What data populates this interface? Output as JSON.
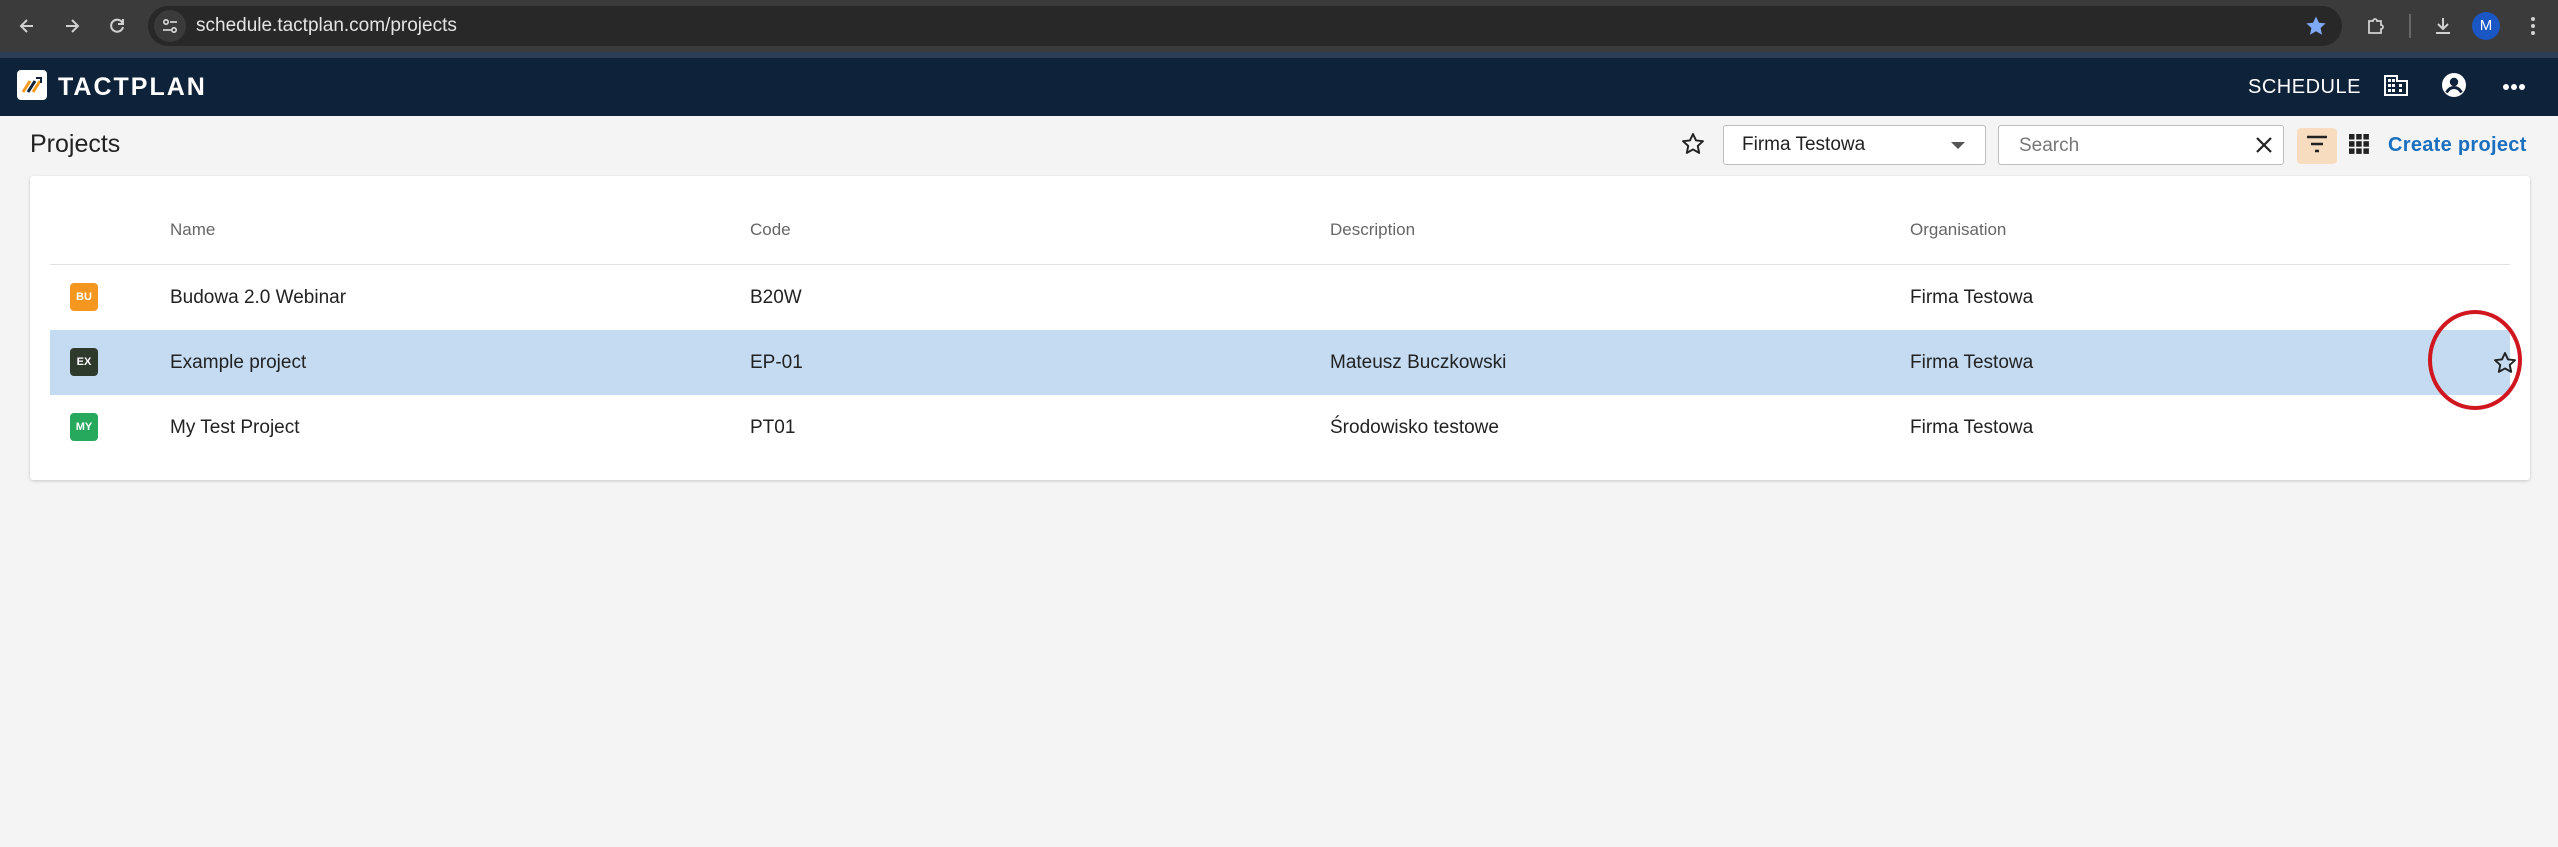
{
  "browser": {
    "url": "schedule.tactplan.com/projects",
    "profile_initial": "M"
  },
  "app": {
    "logo_text": "TACTPLAN",
    "nav_schedule": "SCHEDULE"
  },
  "toolbar": {
    "page_title": "Projects",
    "organisation_selected": "Firma Testowa",
    "search_placeholder": "Search",
    "create_project": "Create project"
  },
  "table": {
    "headers": [
      "Name",
      "Code",
      "Description",
      "Organisation"
    ],
    "rows": [
      {
        "badge": "BU",
        "badge_color": "#f5961f",
        "name": "Budowa 2.0 Webinar",
        "code": "B20W",
        "description": "",
        "organisation": "Firma Testowa",
        "selected": false
      },
      {
        "badge": "EX",
        "badge_color": "#2e3b2c",
        "name": "Example project",
        "code": "EP-01",
        "description": "Mateusz Buczkowski",
        "organisation": "Firma Testowa",
        "selected": true
      },
      {
        "badge": "MY",
        "badge_color": "#27a95d",
        "name": "My Test Project",
        "code": "PT01",
        "description": "Środowisko testowe",
        "organisation": "Firma Testowa",
        "selected": false
      }
    ]
  },
  "colors": {
    "header_bg": "#0e2239",
    "accent_link": "#1a6fbf",
    "selected_row": "#c4dbf2",
    "filter_active": "#f8dcc0",
    "highlight_ring": "#d0161e"
  },
  "icons": {
    "back": "arrow-left-icon",
    "forward": "arrow-right-icon",
    "reload": "reload-icon",
    "site_info": "tune-icon",
    "bookmark": "star-filled-icon",
    "extensions": "puzzle-icon",
    "download": "download-icon",
    "menu": "kebab-menu-icon",
    "organisation": "building-icon",
    "account": "account-circle-icon",
    "more": "more-horizontal-icon",
    "favourite": "star-outline-icon",
    "filter": "filter-icon",
    "grid_view": "grid-icon",
    "clear": "close-icon"
  }
}
